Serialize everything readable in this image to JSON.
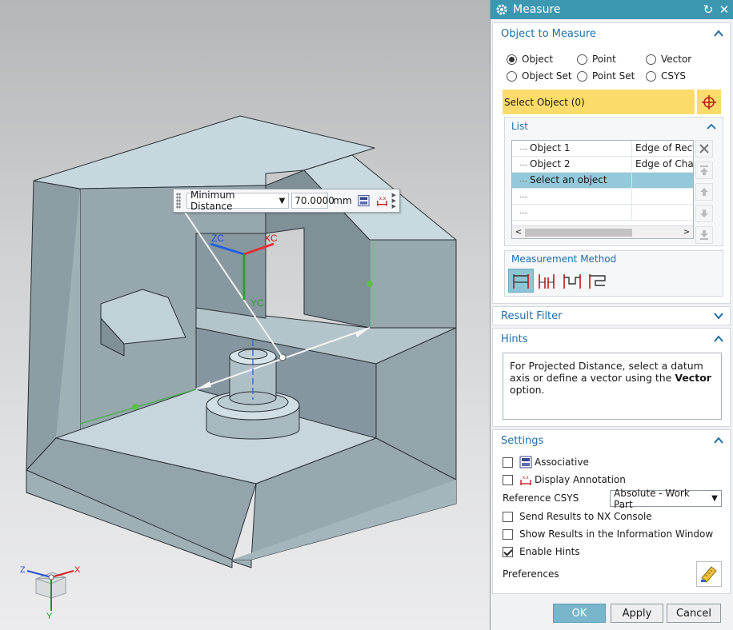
{
  "dialog": {
    "title": "Measure",
    "object_to_measure": {
      "header": "Object to Measure",
      "radio_options": [
        {
          "label": "Object",
          "selected": true
        },
        {
          "label": "Point",
          "selected": false
        },
        {
          "label": "Vector",
          "selected": false
        },
        {
          "label": "Object Set",
          "selected": false
        },
        {
          "label": "Point Set",
          "selected": false
        },
        {
          "label": "CSYS",
          "selected": false
        }
      ],
      "select_object_label": "Select Object (0)",
      "list": {
        "header": "List",
        "rows": [
          {
            "name": "Object 1",
            "type": "Edge of Rectangular Block",
            "selected": false
          },
          {
            "name": "Object 2",
            "type": "Edge of Chamfer",
            "selected": false
          },
          {
            "name": "Select an object",
            "type": "",
            "selected": true
          }
        ]
      },
      "measurement_method": {
        "header": "Measurement Method"
      }
    },
    "result_filter": {
      "header": "Result Filter"
    },
    "hints": {
      "header": "Hints",
      "text_before": "For Projected Distance, select a datum axis or define a vector using the ",
      "text_bold": "Vector",
      "text_after": " option."
    },
    "settings": {
      "header": "Settings",
      "associative": {
        "label": "Associative",
        "checked": false
      },
      "display_annotation": {
        "label": "Display Annotation",
        "checked": false
      },
      "reference_csys_label": "Reference CSYS",
      "reference_csys_value": "Absolute - Work Part",
      "send_results": {
        "label": "Send Results to NX Console",
        "checked": false
      },
      "show_results": {
        "label": "Show Results in the Information Window",
        "checked": false
      },
      "enable_hints": {
        "label": "Enable Hints",
        "checked": true
      },
      "preferences_label": "Preferences"
    },
    "buttons": {
      "ok": "OK",
      "apply": "Apply",
      "cancel": "Cancel"
    }
  },
  "viewport": {
    "measure_toolbar": {
      "type": "Minimum Distance",
      "value": "70.0000",
      "unit": "mm"
    },
    "datum_labels": {
      "zc": "ZC",
      "xc": "XC",
      "yc": "YC"
    },
    "triad_labels": {
      "z": "Z",
      "x": "X",
      "y": "Y"
    }
  },
  "colors": {
    "title_bar": "#3c97b1",
    "selection_highlight": "#fbdc6b",
    "list_selection": "#93c9da",
    "ok_button": "#79b6cb",
    "group_header_text": "#1e6fa7",
    "model_face": "#a9b8bd"
  }
}
